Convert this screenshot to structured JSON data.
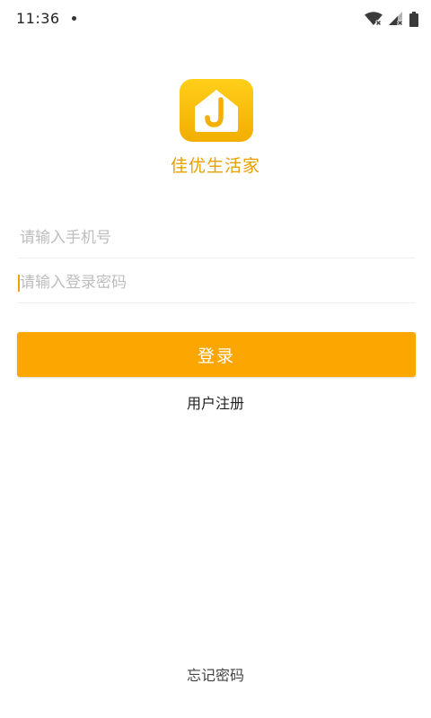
{
  "status_bar": {
    "time": "11:36",
    "icons": [
      "notification-dot-icon",
      "wifi-off-icon",
      "signal-off-icon",
      "battery-icon"
    ]
  },
  "app": {
    "name": "佳优生活家",
    "logo_letter": "J",
    "accent_color": "#fca701",
    "logo_color": "#f5bf00"
  },
  "login_form": {
    "phone_placeholder": "请输入手机号",
    "phone_value": "",
    "password_placeholder": "请输入登录密码",
    "password_value": "",
    "login_label": "登录",
    "register_label": "用户注册",
    "forgot_label": "忘记密码"
  }
}
